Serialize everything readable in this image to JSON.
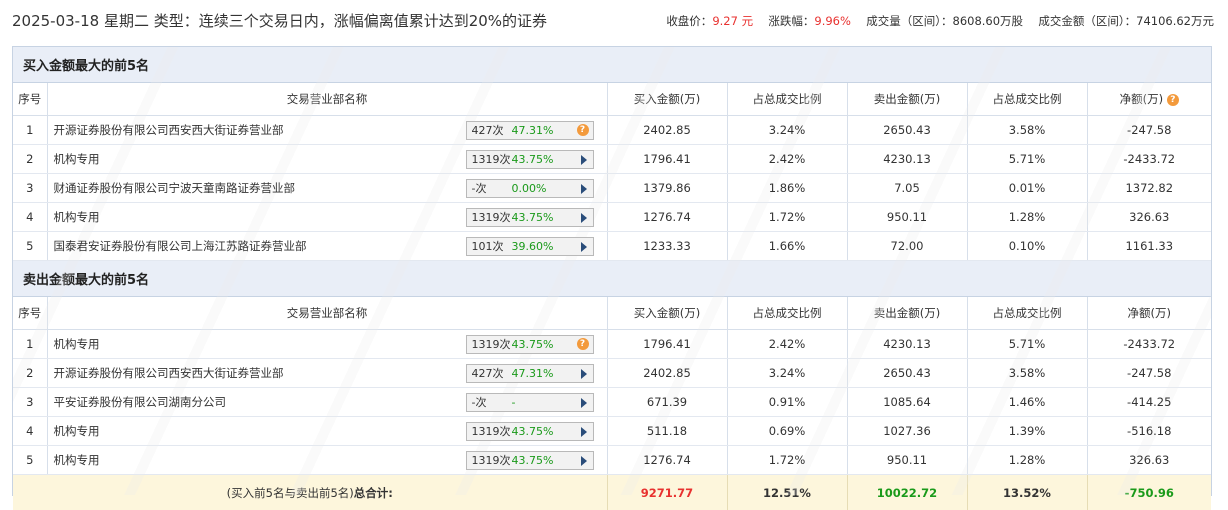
{
  "header": {
    "title": "2025-03-18 星期二 类型：连续三个交易日内，涨幅偏离值累计达到20%的证券",
    "close_label": "收盘价：",
    "close_value": "9.27 元",
    "change_label": "涨跌幅：",
    "change_value": "9.96%",
    "volume_label": "成交量（区间）：",
    "volume_value": "8608.60万股",
    "amount_label": "成交金额（区间）：",
    "amount_value": "74106.62万元"
  },
  "buy_section": {
    "title": "买入金额最大的前5名",
    "headers": [
      "序号",
      "交易营业部名称",
      "买入金额(万)",
      "占总成交比例",
      "卖出金额(万)",
      "占总成交比例",
      "净额(万)"
    ],
    "rows": [
      {
        "idx": "1",
        "name": "开源证券股份有限公司西安西大街证券营业部",
        "count": "427次",
        "rate": "47.31%",
        "icon": "question",
        "buy": "2402.85",
        "buy_pct": "3.24%",
        "sell": "2650.43",
        "sell_pct": "3.58%",
        "net": "-247.58",
        "net_sign": "neg"
      },
      {
        "idx": "2",
        "name": "机构专用",
        "count": "1319次",
        "rate": "43.75%",
        "icon": "arrow",
        "buy": "1796.41",
        "buy_pct": "2.42%",
        "sell": "4230.13",
        "sell_pct": "5.71%",
        "net": "-2433.72",
        "net_sign": "neg"
      },
      {
        "idx": "3",
        "name": "财通证券股份有限公司宁波天童南路证券营业部",
        "count": "-次",
        "rate": "0.00%",
        "icon": "arrow",
        "buy": "1379.86",
        "buy_pct": "1.86%",
        "sell": "7.05",
        "sell_pct": "0.01%",
        "net": "1372.82",
        "net_sign": "pos"
      },
      {
        "idx": "4",
        "name": "机构专用",
        "count": "1319次",
        "rate": "43.75%",
        "icon": "arrow",
        "buy": "1276.74",
        "buy_pct": "1.72%",
        "sell": "950.11",
        "sell_pct": "1.28%",
        "net": "326.63",
        "net_sign": "pos"
      },
      {
        "idx": "5",
        "name": "国泰君安证券股份有限公司上海江苏路证券营业部",
        "count": "101次",
        "rate": "39.60%",
        "icon": "arrow",
        "buy": "1233.33",
        "buy_pct": "1.66%",
        "sell": "72.00",
        "sell_pct": "0.10%",
        "net": "1161.33",
        "net_sign": "pos"
      }
    ]
  },
  "sell_section": {
    "title": "卖出金额最大的前5名",
    "headers": [
      "序号",
      "交易营业部名称",
      "买入金额(万)",
      "占总成交比例",
      "卖出金额(万)",
      "占总成交比例",
      "净额(万)"
    ],
    "rows": [
      {
        "idx": "1",
        "name": "机构专用",
        "count": "1319次",
        "rate": "43.75%",
        "icon": "question",
        "buy": "1796.41",
        "buy_pct": "2.42%",
        "sell": "4230.13",
        "sell_pct": "5.71%",
        "net": "-2433.72",
        "net_sign": "neg"
      },
      {
        "idx": "2",
        "name": "开源证券股份有限公司西安西大街证券营业部",
        "count": "427次",
        "rate": "47.31%",
        "icon": "arrow",
        "buy": "2402.85",
        "buy_pct": "3.24%",
        "sell": "2650.43",
        "sell_pct": "3.58%",
        "net": "-247.58",
        "net_sign": "neg"
      },
      {
        "idx": "3",
        "name": "平安证券股份有限公司湖南分公司",
        "count": "-次",
        "rate": "-",
        "icon": "arrow",
        "buy": "671.39",
        "buy_pct": "0.91%",
        "sell": "1085.64",
        "sell_pct": "1.46%",
        "net": "-414.25",
        "net_sign": "neg"
      },
      {
        "idx": "4",
        "name": "机构专用",
        "count": "1319次",
        "rate": "43.75%",
        "icon": "arrow",
        "buy": "511.18",
        "buy_pct": "0.69%",
        "sell": "1027.36",
        "sell_pct": "1.39%",
        "net": "-516.18",
        "net_sign": "neg"
      },
      {
        "idx": "5",
        "name": "机构专用",
        "count": "1319次",
        "rate": "43.75%",
        "icon": "arrow",
        "buy": "1276.74",
        "buy_pct": "1.72%",
        "sell": "950.11",
        "sell_pct": "1.28%",
        "net": "326.63",
        "net_sign": "pos"
      }
    ]
  },
  "total": {
    "label_prefix": "(买入前5名与卖出前5名)",
    "label_bold": "总合计:",
    "buy": "9271.77",
    "buy_pct": "12.51%",
    "sell": "10022.72",
    "sell_pct": "13.52%",
    "net": "-750.96"
  },
  "colors": {
    "red": "#e8312f",
    "green": "#1a9a1a",
    "section_bg": "#e9eef7",
    "total_bg": "#fdf6dc"
  },
  "icons": {
    "question": "question-icon",
    "arrow": "play-arrow-icon"
  }
}
